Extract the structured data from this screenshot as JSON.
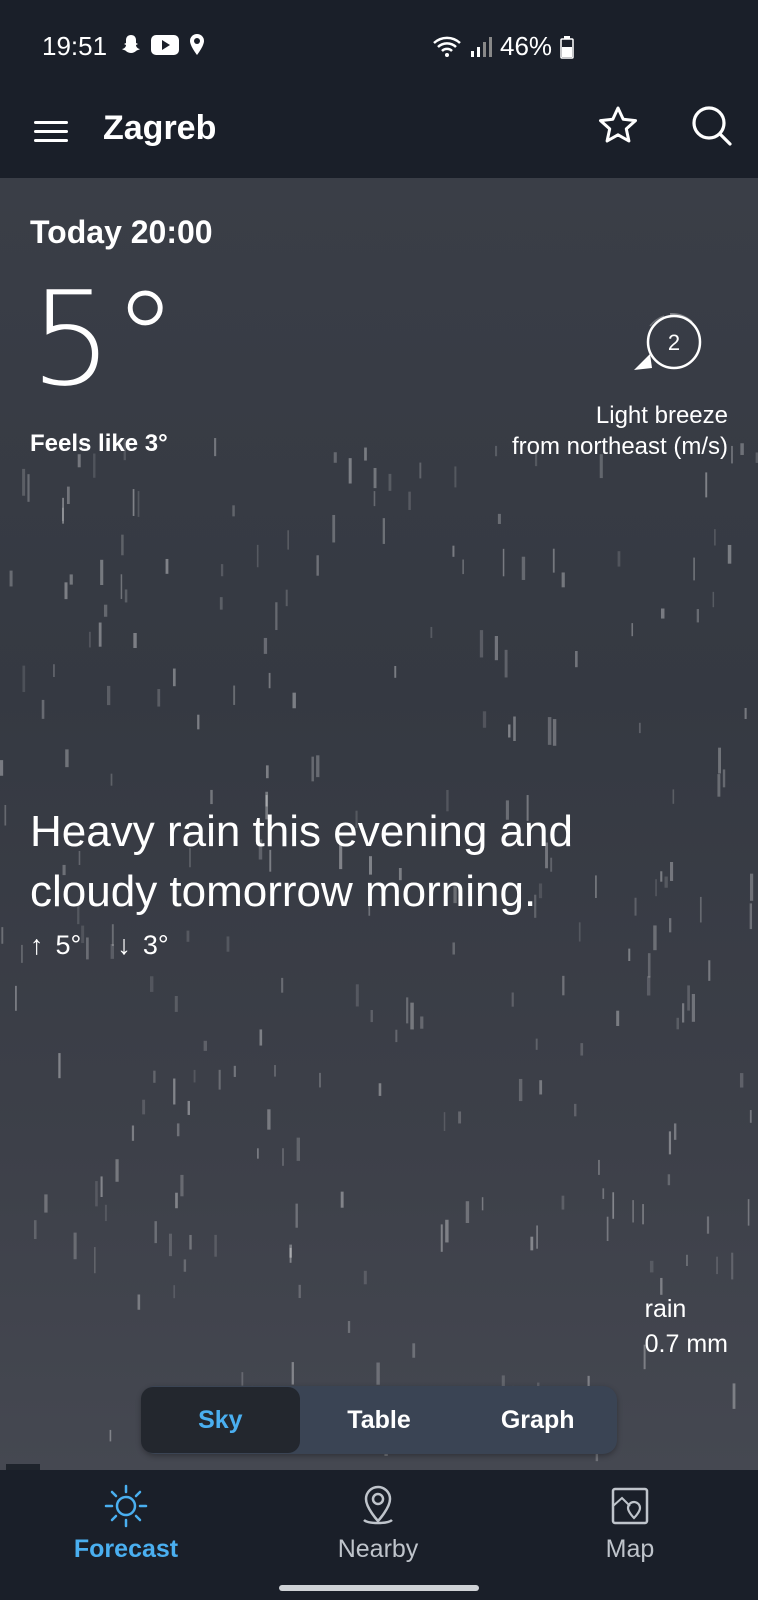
{
  "status_bar": {
    "time": "19:51",
    "battery": "46%"
  },
  "app_bar": {
    "title": "Zagreb"
  },
  "current": {
    "time_label": "Today 20:00",
    "temperature": "5°",
    "feels_like": "Feels like 3°",
    "wind_speed": "2",
    "wind_line1": "Light breeze",
    "wind_line2": "from northeast (m/s)"
  },
  "summary": {
    "text": "Heavy rain this evening and cloudy tomorrow morning.",
    "high": "5°",
    "low": "3°",
    "rain_label": "rain",
    "rain_amount": "0.7 mm"
  },
  "view_tabs": {
    "sky": "Sky",
    "table": "Table",
    "graph": "Graph",
    "selected": "Sky"
  },
  "bottom_nav": {
    "forecast": "Forecast",
    "nearby": "Nearby",
    "map": "Map"
  },
  "colors": {
    "accent": "#4aaff0",
    "bar_bg": "#1a1f29"
  }
}
